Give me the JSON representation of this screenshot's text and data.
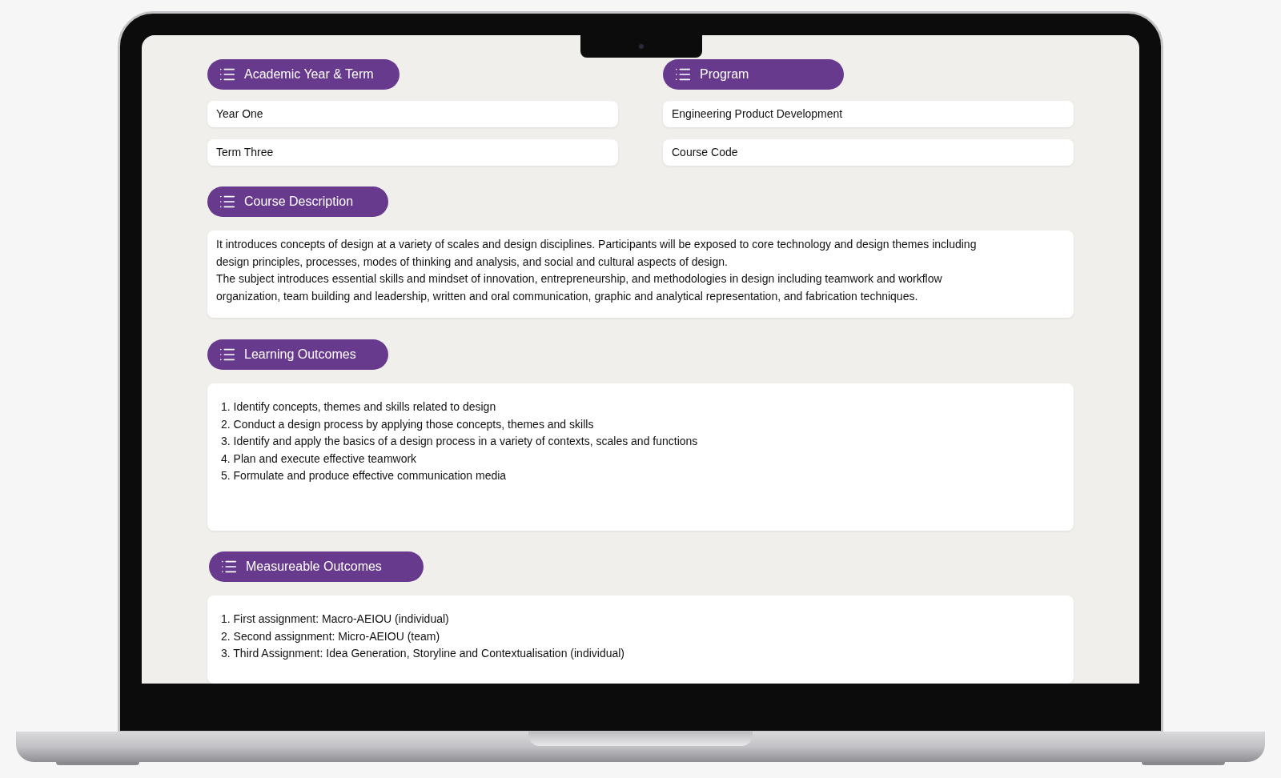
{
  "top_left": {
    "heading": "Academic Year & Term",
    "fields": [
      "Year One",
      "Term Three"
    ]
  },
  "top_right": {
    "heading": "Program",
    "fields": [
      "Engineering Product Development",
      "Course Code"
    ]
  },
  "course_description": {
    "heading": "Course Description",
    "paragraphs": [
      "It introduces concepts of design at a variety of scales and design disciplines. Participants will be exposed to core technology and design themes including design principles, processes, modes of thinking and analysis, and social and cultural aspects of design.",
      "The subject introduces essential skills and mindset of innovation, entrepreneurship, and methodologies in design including teamwork and workflow organization, team building and leadership, written and oral communication, graphic and analytical representation, and fabrication techniques."
    ]
  },
  "learning_outcomes": {
    "heading": "Learning Outcomes",
    "items": [
      "1. Identify concepts, themes and skills related to design",
      "2. Conduct a design process by applying those concepts, themes and skills",
      "3. Identify and apply the basics of a design process in a variety of contexts, scales and functions",
      "4. Plan and execute effective teamwork",
      "5. Formulate and produce effective communication media"
    ]
  },
  "measurable_outcomes": {
    "heading": "Measureable Outcomes",
    "items": [
      "1. First assignment: Macro-AEIOU (individual)",
      "2. Second assignment: Micro-AEIOU (team)",
      "3. Third Assignment: Idea Generation, Storyline and Contextualisation (individual)"
    ]
  }
}
